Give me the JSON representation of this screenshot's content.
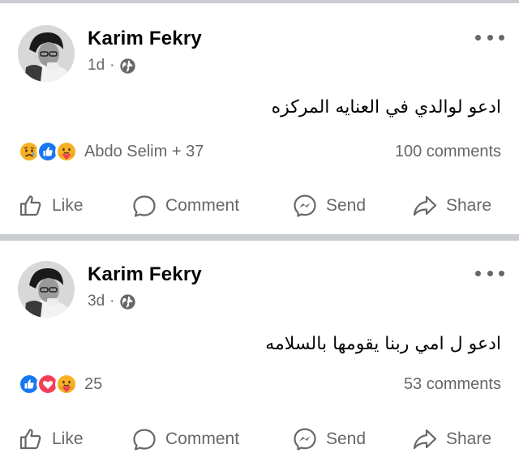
{
  "posts": [
    {
      "author": "Karim Fekry",
      "time": "1d",
      "separator": "·",
      "text": "ادعو لوالدي في العنايه المركزه",
      "reactions": [
        "sad",
        "like",
        "care"
      ],
      "reaction_summary": "Abdo Selim + 37",
      "comments": "100 comments",
      "actions": {
        "like": "Like",
        "comment": "Comment",
        "send": "Send",
        "share": "Share"
      }
    },
    {
      "author": "Karim Fekry",
      "time": "3d",
      "separator": "·",
      "text": "ادعو ل امي ربنا يقومها بالسلامه",
      "reactions": [
        "like",
        "love",
        "care"
      ],
      "reaction_summary": "25",
      "comments": "53 comments",
      "actions": {
        "like": "Like",
        "comment": "Comment",
        "send": "Send",
        "share": "Share"
      }
    }
  ],
  "icons": {
    "avatar": "avatar-icon",
    "privacy": "globe-icon",
    "more": "more-options-icon",
    "like": "thumbs-up-icon",
    "comment": "comment-bubble-icon",
    "send": "messenger-icon",
    "share": "share-arrow-icon"
  },
  "colors": {
    "text": "#050505",
    "secondary": "#65676b",
    "like_blue": "#1877f2",
    "love_red": "#f33e58",
    "emoji_yellow": "#f7b125",
    "divider": "#c9ccd1"
  }
}
